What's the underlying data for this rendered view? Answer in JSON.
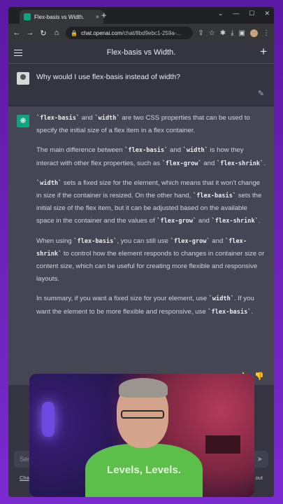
{
  "browser": {
    "tab_title": "Flex-basis vs Width.",
    "tab_close": "×",
    "new_tab": "+",
    "url_host": "chat.openai.com",
    "url_path": "/chat/8bd9ebc1-259a-..."
  },
  "chat": {
    "header_title": "Flex-basis vs Width.",
    "new_chat": "+",
    "user_question": "Why would I use flex-basis instead of width?",
    "answer": [
      {
        "segments": [
          {
            "code": true,
            "text": "`flex-basis`"
          },
          {
            "code": false,
            "text": " and "
          },
          {
            "code": true,
            "text": "`width`"
          },
          {
            "code": false,
            "text": " are two CSS properties that can be used to specify the initial size of a flex item in a flex container."
          }
        ]
      },
      {
        "segments": [
          {
            "code": false,
            "text": "The main difference between "
          },
          {
            "code": true,
            "text": "`flex-basis`"
          },
          {
            "code": false,
            "text": " and "
          },
          {
            "code": true,
            "text": "`width`"
          },
          {
            "code": false,
            "text": " is how they interact with other flex properties, such as "
          },
          {
            "code": true,
            "text": "`flex-grow`"
          },
          {
            "code": false,
            "text": " and "
          },
          {
            "code": true,
            "text": "`flex-shrink`"
          },
          {
            "code": false,
            "text": "."
          }
        ]
      },
      {
        "segments": [
          {
            "code": true,
            "text": "`width`"
          },
          {
            "code": false,
            "text": " sets a fixed size for the element, which means that it won't change in size if the container is resized. On the other hand, "
          },
          {
            "code": true,
            "text": "`flex-basis`"
          },
          {
            "code": false,
            "text": " sets the initial size of the flex item, but it can be adjusted based on the available space in the container and the values of "
          },
          {
            "code": true,
            "text": "`flex-grow`"
          },
          {
            "code": false,
            "text": " and "
          },
          {
            "code": true,
            "text": "`flex-shrink`"
          },
          {
            "code": false,
            "text": "."
          }
        ]
      },
      {
        "segments": [
          {
            "code": false,
            "text": "When using "
          },
          {
            "code": true,
            "text": "`flex-basis`"
          },
          {
            "code": false,
            "text": ", you can still use "
          },
          {
            "code": true,
            "text": "`flex-grow`"
          },
          {
            "code": false,
            "text": " and "
          },
          {
            "code": true,
            "text": "`flex-shrink`"
          },
          {
            "code": false,
            "text": " to control how the element responds to changes in container size or content size, which can be useful for creating more flexible and responsive layouts."
          }
        ]
      },
      {
        "segments": [
          {
            "code": false,
            "text": "In summary, if you want a fixed size for your element, use "
          },
          {
            "code": true,
            "text": "`width`"
          },
          {
            "code": false,
            "text": ". If you want the element to be more flexible and responsive, use "
          },
          {
            "code": true,
            "text": "`flex-basis`"
          },
          {
            "code": false,
            "text": "."
          }
        ]
      }
    ],
    "input_placeholder": "Sen",
    "footer_left": "Cha",
    "footer_right": "out"
  },
  "webcam": {
    "shirt_text": "Levels, Levels."
  },
  "colors": {
    "accent": "#10a37f",
    "page_bg": "#6d22b8",
    "chat_bg": "#343541",
    "answer_bg": "#444654"
  }
}
